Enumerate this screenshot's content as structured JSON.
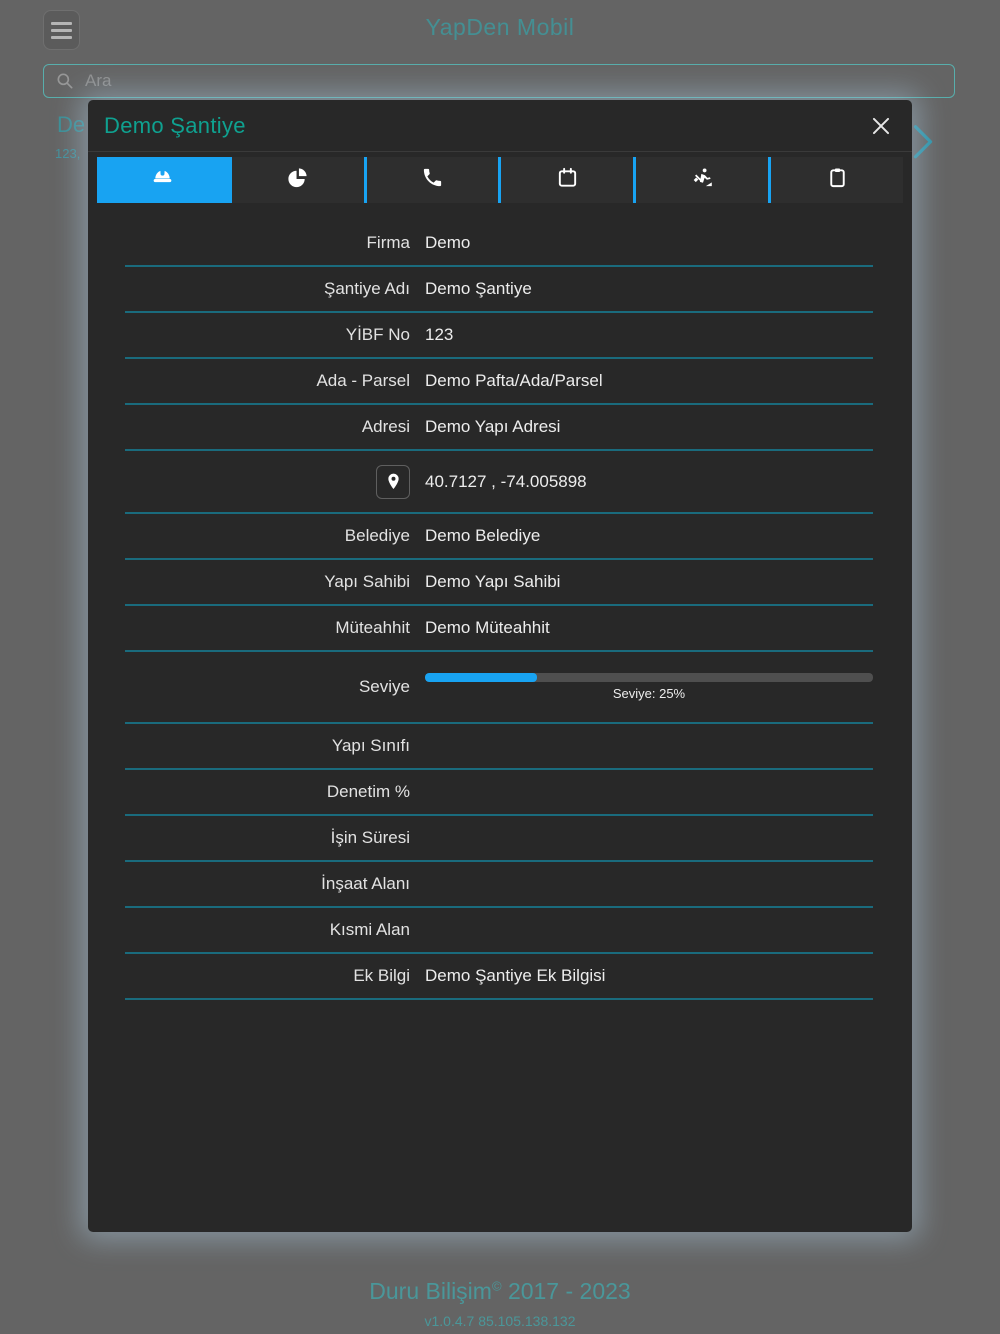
{
  "app": {
    "title": "YapDen Mobil"
  },
  "menu": {
    "icon": "hamburger-menu-icon"
  },
  "search": {
    "placeholder": "Ara",
    "icon": "search-icon"
  },
  "background_list_item": {
    "title_fragment": "De",
    "subtitle_fragment": "123,",
    "chevron_icon": "chevron-right-icon"
  },
  "modal": {
    "title": "Demo Şantiye",
    "close_icon": "close-icon",
    "tabs": [
      {
        "name": "tab-site-info",
        "icon": "hard-hat-icon",
        "active": true
      },
      {
        "name": "tab-statistics",
        "icon": "pie-chart-icon",
        "active": false
      },
      {
        "name": "tab-contacts",
        "icon": "phone-icon",
        "active": false
      },
      {
        "name": "tab-calendar",
        "icon": "calendar-icon",
        "active": false
      },
      {
        "name": "tab-works",
        "icon": "worker-digging-icon",
        "active": false
      },
      {
        "name": "tab-documents",
        "icon": "clipboard-icon",
        "active": false
      }
    ],
    "fields": [
      {
        "type": "text",
        "label": "Firma",
        "value": "Demo"
      },
      {
        "type": "text",
        "label": "Şantiye Adı",
        "value": "Demo Şantiye"
      },
      {
        "type": "text",
        "label": "YİBF No",
        "value": "123"
      },
      {
        "type": "text",
        "label": "Ada - Parsel",
        "value": "Demo Pafta/Ada/Parsel"
      },
      {
        "type": "text",
        "label": "Adresi",
        "value": "Demo Yapı Adresi"
      },
      {
        "type": "location",
        "icon": "location-pin-icon",
        "value": "40.7127 , -74.005898"
      },
      {
        "type": "text",
        "label": "Belediye",
        "value": "Demo Belediye"
      },
      {
        "type": "text",
        "label": "Yapı Sahibi",
        "value": "Demo Yapı Sahibi"
      },
      {
        "type": "text",
        "label": "Müteahhit",
        "value": "Demo Müteahhit"
      },
      {
        "type": "progress",
        "label": "Seviye",
        "percent": 25,
        "caption": "Seviye: 25%"
      },
      {
        "type": "text",
        "label": "Yapı Sınıfı",
        "value": ""
      },
      {
        "type": "text",
        "label": "Denetim %",
        "value": ""
      },
      {
        "type": "text",
        "label": "İşin Süresi",
        "value": ""
      },
      {
        "type": "text",
        "label": "İnşaat Alanı",
        "value": ""
      },
      {
        "type": "text",
        "label": "Kısmi Alan",
        "value": ""
      },
      {
        "type": "text",
        "label": "Ek Bilgi",
        "value": "Demo Şantiye Ek Bilgisi"
      }
    ]
  },
  "footer": {
    "brand": "Duru Bilişim",
    "copyright_mark": "©",
    "years": "2017 - 2023",
    "version": "v1.0.4.7 85.105.138.132"
  },
  "colors": {
    "accent_blue": "#18a3f2",
    "accent_teal": "#0fa190",
    "divider_teal": "#1a6b7d",
    "page_bg": "#646464",
    "modal_bg": "#282828"
  }
}
